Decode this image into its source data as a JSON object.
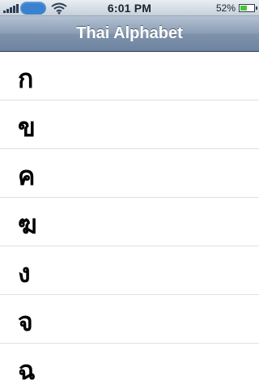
{
  "status_bar": {
    "time": "6:01 PM",
    "battery_percent": "52%",
    "battery_level": 0.52,
    "signal_bars": 5,
    "icons": [
      "signal-bars-icon",
      "carrier-pill-icon",
      "wifi-icon",
      "battery-icon"
    ]
  },
  "navbar": {
    "title": "Thai Alphabet"
  },
  "list": {
    "items": [
      {
        "letter": "ก"
      },
      {
        "letter": "ข"
      },
      {
        "letter": "ค"
      },
      {
        "letter": "ฆ"
      },
      {
        "letter": "ง"
      },
      {
        "letter": "จ"
      },
      {
        "letter": "ฉ"
      }
    ]
  },
  "colors": {
    "navbar_top": "#b3c1d2",
    "navbar_bottom": "#6e83a0",
    "carrier_pill": "#3a82d0",
    "battery_fill": "#4ac23a",
    "row_separator": "#e0e0e0"
  }
}
